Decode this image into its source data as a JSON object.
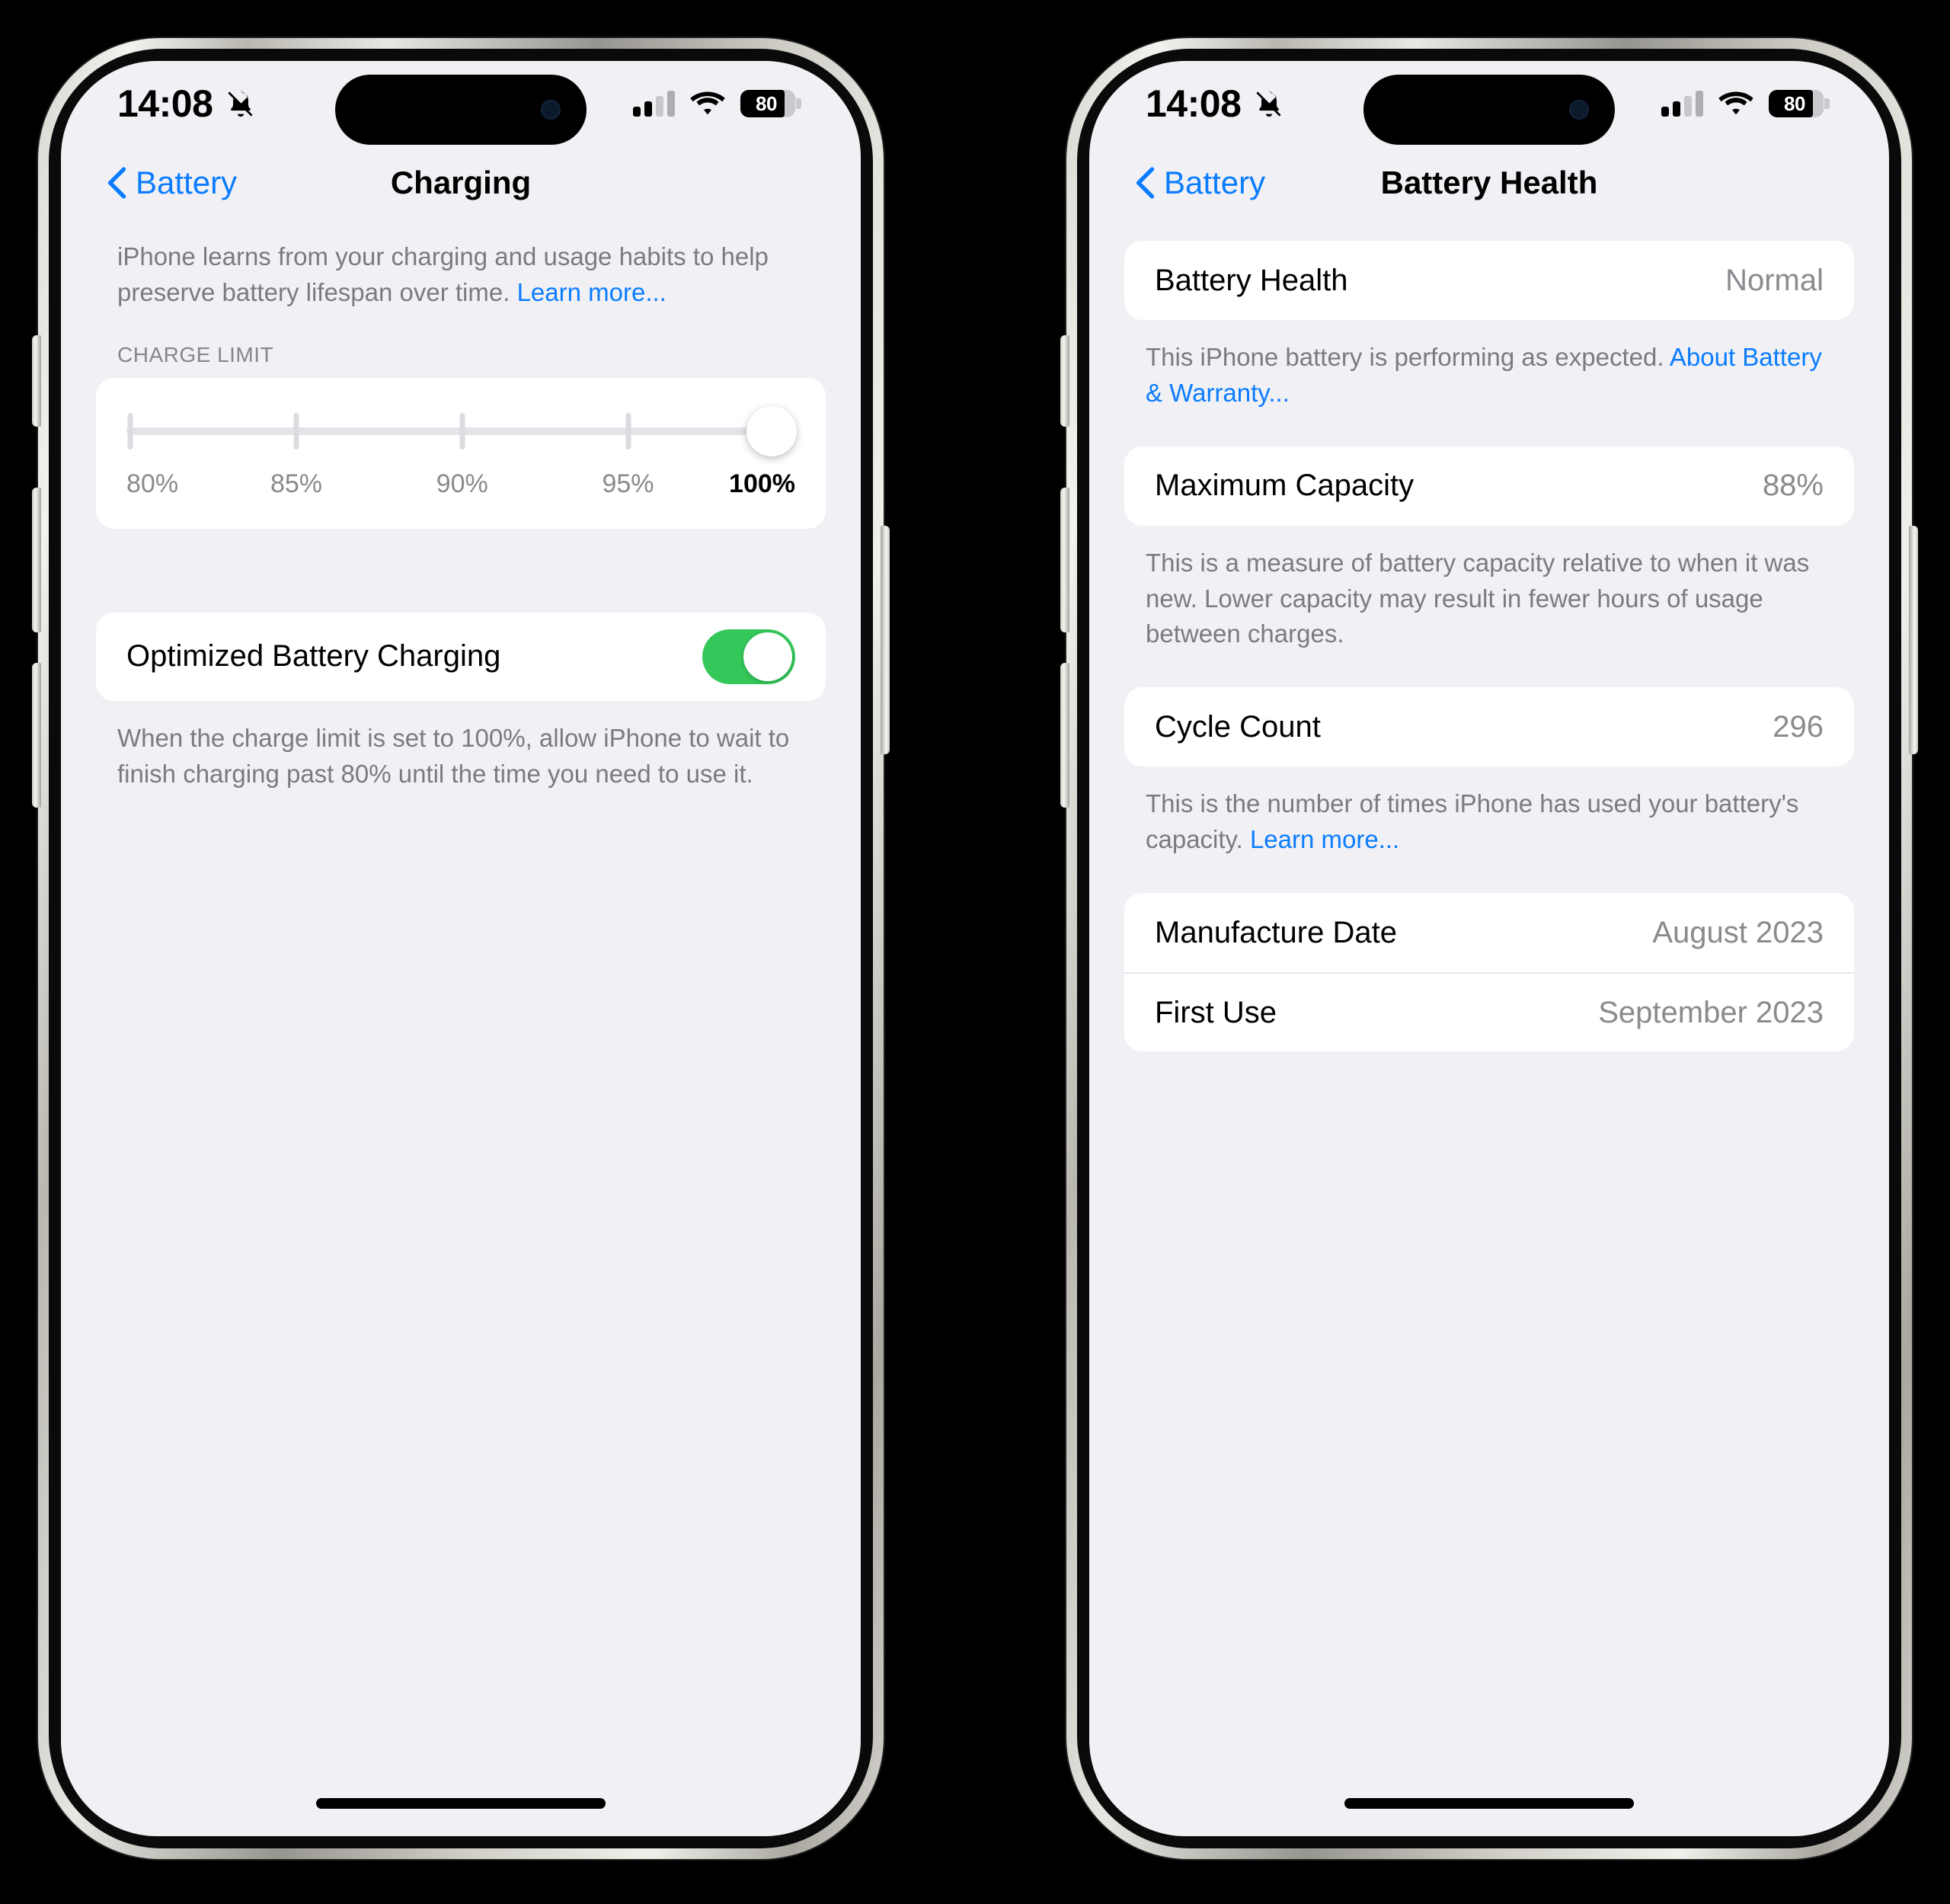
{
  "status_bar": {
    "time": "14:08",
    "silent_icon": "bell-slash-icon",
    "signal_icon": "cellular-signal-icon",
    "signal_bars_filled": 2,
    "signal_bars_total": 4,
    "wifi_icon": "wifi-icon",
    "battery_percent": "80",
    "battery_level": 80
  },
  "phone_left": {
    "nav": {
      "back_label": "Battery",
      "title": "Charging"
    },
    "intro": {
      "text": "iPhone learns from your charging and usage habits to help preserve battery lifespan over time. ",
      "link": "Learn more..."
    },
    "charge_limit": {
      "header": "CHARGE LIMIT",
      "ticks": [
        "80%",
        "85%",
        "90%",
        "95%",
        "100%"
      ],
      "selected": "100%",
      "selected_index": 4
    },
    "optimized": {
      "label": "Optimized Battery Charging",
      "enabled": true,
      "footnote": "When the charge limit is set to 100%, allow iPhone to wait to finish charging past 80% until the time you need to use it."
    }
  },
  "phone_right": {
    "nav": {
      "back_label": "Battery",
      "title": "Battery Health"
    },
    "battery_health": {
      "label": "Battery Health",
      "value": "Normal",
      "footnote_text": "This iPhone battery is performing as expected. ",
      "footnote_link": "About Battery & Warranty..."
    },
    "maximum_capacity": {
      "label": "Maximum Capacity",
      "value": "88%",
      "footnote": "This is a measure of battery capacity relative to when it was new. Lower capacity may result in fewer hours of usage between charges."
    },
    "cycle_count": {
      "label": "Cycle Count",
      "value": "296",
      "footnote_text": "This is the number of times iPhone has used your battery's capacity. ",
      "footnote_link": "Learn more..."
    },
    "dates": [
      {
        "label": "Manufacture Date",
        "value": "August 2023"
      },
      {
        "label": "First Use",
        "value": "September 2023"
      }
    ]
  },
  "colors": {
    "accent_blue": "#0a7cff",
    "toggle_green": "#34c759",
    "background": "#f1f1f5",
    "card": "#ffffff"
  }
}
